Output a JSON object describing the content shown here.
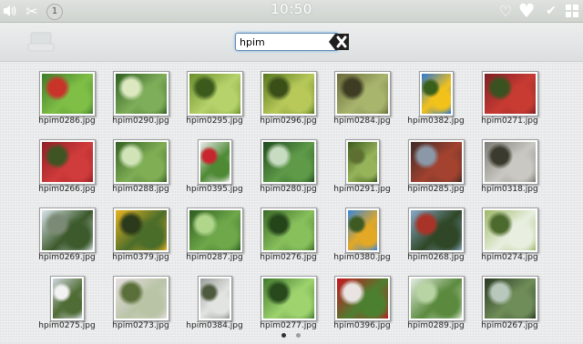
{
  "statusbar": {
    "time": "10:50",
    "notification_count": "1",
    "icons": [
      "volume-icon",
      "scissors-icon",
      "heart-outline-icon",
      "heart-icon",
      "check-icon",
      "grid-icon"
    ]
  },
  "search": {
    "value": "hpim",
    "placeholder": ""
  },
  "gallery": {
    "items": [
      {
        "name": "hpim0286.jpg",
        "shape": "wide",
        "colors": [
          "#3f7b2a",
          "#7fbf46",
          "#c8342a"
        ]
      },
      {
        "name": "hpim0290.jpg",
        "shape": "wide",
        "colors": [
          "#2f5f22",
          "#7fae5a",
          "#dbe8c0"
        ]
      },
      {
        "name": "hpim0295.jpg",
        "shape": "wide",
        "colors": [
          "#6a8f2c",
          "#b6d26a",
          "#3c5a1c"
        ]
      },
      {
        "name": "hpim0296.jpg",
        "shape": "wide",
        "colors": [
          "#58781f",
          "#b8c95a",
          "#3a4e18"
        ]
      },
      {
        "name": "hpim0284.jpg",
        "shape": "wide",
        "colors": [
          "#6b6a3a",
          "#a8b56d",
          "#3e3d24"
        ]
      },
      {
        "name": "hpim0382.jpg",
        "shape": "narrow",
        "colors": [
          "#2d78d0",
          "#f3c21a",
          "#3a5f1a"
        ]
      },
      {
        "name": "hpim0271.jpg",
        "shape": "wide",
        "colors": [
          "#7d1f24",
          "#c83b33",
          "#3a5220"
        ]
      },
      {
        "name": "hpim0266.jpg",
        "shape": "wide",
        "colors": [
          "#8f1f27",
          "#d03b3b",
          "#3e5423"
        ]
      },
      {
        "name": "hpim0288.jpg",
        "shape": "wide",
        "colors": [
          "#355f22",
          "#7fae55",
          "#d0e4b8"
        ]
      },
      {
        "name": "hpim0395.jpg",
        "shape": "narrow",
        "colors": [
          "#e9e9e9",
          "#4d8a33",
          "#c8262e"
        ]
      },
      {
        "name": "hpim0280.jpg",
        "shape": "wide",
        "colors": [
          "#1f4a1e",
          "#5e9a48",
          "#c7dcc0"
        ]
      },
      {
        "name": "hpim0291.jpg",
        "shape": "narrow",
        "colors": [
          "#3c5a1b",
          "#96b45a",
          "#5d7031"
        ]
      },
      {
        "name": "hpim0285.jpg",
        "shape": "wide",
        "colors": [
          "#3e2c28",
          "#a2422f",
          "#8b98a8"
        ]
      },
      {
        "name": "hpim0318.jpg",
        "shape": "wide",
        "colors": [
          "#7d7c77",
          "#c9c8c2",
          "#3a3b2e"
        ]
      },
      {
        "name": "hpim0269.jpg",
        "shape": "wide",
        "colors": [
          "#d9e3ea",
          "#3c5a2c",
          "#7b8a74"
        ]
      },
      {
        "name": "hpim0379.jpg",
        "shape": "wide",
        "colors": [
          "#e8b220",
          "#4b6d2a",
          "#2b3a1a"
        ]
      },
      {
        "name": "hpim0287.jpg",
        "shape": "wide",
        "colors": [
          "#2d5c20",
          "#6fa84a",
          "#b0d68c"
        ]
      },
      {
        "name": "hpim0276.jpg",
        "shape": "wide",
        "colors": [
          "#3b6b27",
          "#88c05c",
          "#24441a"
        ]
      },
      {
        "name": "hpim0380.jpg",
        "shape": "narrow",
        "colors": [
          "#3a86d8",
          "#e3a825",
          "#3d5a22"
        ]
      },
      {
        "name": "hpim0268.jpg",
        "shape": "wide",
        "colors": [
          "#8aa8c8",
          "#2f4726",
          "#a83328"
        ]
      },
      {
        "name": "hpim0274.jpg",
        "shape": "wide",
        "colors": [
          "#9eb868",
          "#e8efe0",
          "#4d6a2e"
        ]
      },
      {
        "name": "hpim0275.jpg",
        "shape": "narrow",
        "colors": [
          "#cfd6dc",
          "#4f6c34",
          "#f2f2f2"
        ]
      },
      {
        "name": "hpim0273.jpg",
        "shape": "wide",
        "colors": [
          "#e6dee0",
          "#b9c4a6",
          "#5a6f3a"
        ]
      },
      {
        "name": "hpim0384.jpg",
        "shape": "narrow",
        "colors": [
          "#9b9e9a",
          "#e2e4e1",
          "#4e5a3e"
        ]
      },
      {
        "name": "hpim0277.jpg",
        "shape": "wide",
        "colors": [
          "#417a2e",
          "#9ed36e",
          "#27491c"
        ]
      },
      {
        "name": "hpim0396.jpg",
        "shape": "wide",
        "colors": [
          "#c8141e",
          "#4d7f30",
          "#e9e4e2"
        ]
      },
      {
        "name": "hpim0289.jpg",
        "shape": "wide",
        "colors": [
          "#e3ece0",
          "#5b8a3e",
          "#b8d4a4"
        ]
      },
      {
        "name": "hpim0267.jpg",
        "shape": "wide",
        "colors": [
          "#2a3a24",
          "#6f8d58",
          "#b9c8bd"
        ]
      }
    ]
  },
  "pager": {
    "current": 1,
    "total": 2
  }
}
